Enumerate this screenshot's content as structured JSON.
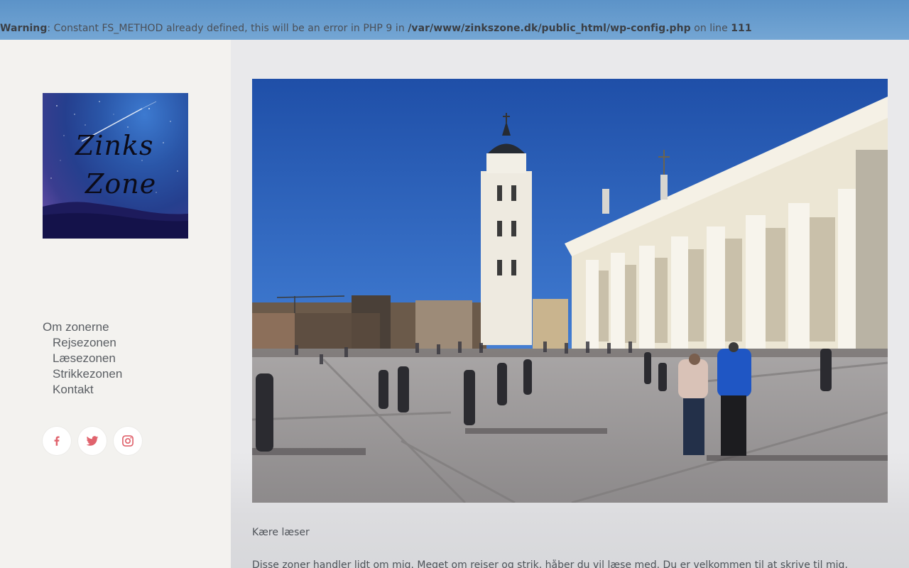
{
  "warning": {
    "label": "Warning",
    "message_1": ": Constant FS_METHOD already defined, this will be an error in PHP 9 in ",
    "path": "/var/www/zinkszone.dk/public_html/wp-config.php",
    "message_2": " on line ",
    "line": "111"
  },
  "logo": {
    "line1": "Zinks",
    "line2": "Zone"
  },
  "nav": {
    "items": [
      {
        "label": "Om zonerne"
      },
      {
        "label": "Rejsezonen"
      },
      {
        "label": "Læsezonen"
      },
      {
        "label": "Strikkezonen"
      },
      {
        "label": "Kontakt"
      }
    ]
  },
  "social": {
    "items": [
      {
        "icon": "facebook-icon"
      },
      {
        "icon": "twitter-icon"
      },
      {
        "icon": "instagram-icon"
      }
    ],
    "icon_color": "#e0636d"
  },
  "content": {
    "caption": "Kære læser",
    "body": "Disse zoner handler lidt om mig. Meget om rejser og strik, håber du vil læse med. Du er velkommen til at skrive til mig, brug"
  }
}
